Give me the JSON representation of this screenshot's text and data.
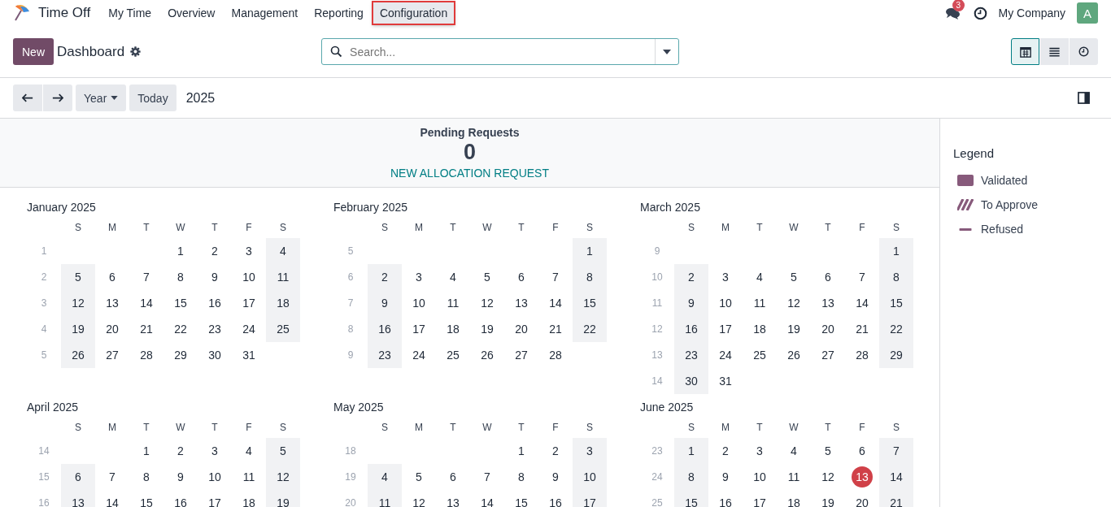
{
  "app": {
    "name": "Time Off"
  },
  "menu": [
    {
      "label": "My Time",
      "highlighted": false
    },
    {
      "label": "Overview",
      "highlighted": false
    },
    {
      "label": "Management",
      "highlighted": false
    },
    {
      "label": "Reporting",
      "highlighted": false
    },
    {
      "label": "Configuration",
      "highlighted": true
    }
  ],
  "systray": {
    "messages_badge": "3",
    "company": "My Company",
    "avatar": "A"
  },
  "control_panel": {
    "new_button": "New",
    "title": "Dashboard",
    "search": {
      "placeholder": "Search..."
    },
    "views": [
      {
        "kind": "calendar",
        "selected": true
      },
      {
        "kind": "list",
        "selected": false
      },
      {
        "kind": "activity",
        "selected": false
      }
    ]
  },
  "toolbar": {
    "scale": "Year",
    "today": "Today",
    "period": "2025"
  },
  "pending": {
    "title": "Pending Requests",
    "count": "0",
    "action": "NEW ALLOCATION REQUEST"
  },
  "months": [
    {
      "title": "January 2025",
      "weekdays": [
        "S",
        "M",
        "T",
        "W",
        "T",
        "F",
        "S"
      ],
      "weeks": [
        {
          "number": "1",
          "days": [
            "1",
            "2",
            "3",
            "4"
          ]
        },
        {
          "number": "2",
          "days": [
            "5",
            "6",
            "7",
            "8",
            "9",
            "10",
            "11"
          ]
        },
        {
          "number": "3",
          "days": [
            "12",
            "13",
            "14",
            "15",
            "16",
            "17",
            "18"
          ]
        },
        {
          "number": "4",
          "days": [
            "19",
            "20",
            "21",
            "22",
            "23",
            "24",
            "25"
          ]
        },
        {
          "number": "5",
          "days": [
            "26",
            "27",
            "28",
            "29",
            "30",
            "31"
          ]
        }
      ]
    },
    {
      "title": "February 2025",
      "weekdays": [
        "S",
        "M",
        "T",
        "W",
        "T",
        "F",
        "S"
      ],
      "weeks": [
        {
          "number": "5",
          "days": [
            "1"
          ]
        },
        {
          "number": "6",
          "days": [
            "2",
            "3",
            "4",
            "5",
            "6",
            "7",
            "8"
          ]
        },
        {
          "number": "7",
          "days": [
            "9",
            "10",
            "11",
            "12",
            "13",
            "14",
            "15"
          ]
        },
        {
          "number": "8",
          "days": [
            "16",
            "17",
            "18",
            "19",
            "20",
            "21",
            "22"
          ]
        },
        {
          "number": "9",
          "days": [
            "23",
            "24",
            "25",
            "26",
            "27",
            "28"
          ]
        }
      ]
    },
    {
      "title": "March 2025",
      "weekdays": [
        "S",
        "M",
        "T",
        "W",
        "T",
        "F",
        "S"
      ],
      "weeks": [
        {
          "number": "9",
          "days": [
            "1"
          ]
        },
        {
          "number": "10",
          "days": [
            "2",
            "3",
            "4",
            "5",
            "6",
            "7",
            "8"
          ]
        },
        {
          "number": "11",
          "days": [
            "9",
            "10",
            "11",
            "12",
            "13",
            "14",
            "15"
          ]
        },
        {
          "number": "12",
          "days": [
            "16",
            "17",
            "18",
            "19",
            "20",
            "21",
            "22"
          ]
        },
        {
          "number": "13",
          "days": [
            "23",
            "24",
            "25",
            "26",
            "27",
            "28",
            "29"
          ]
        },
        {
          "number": "14",
          "days": [
            "30",
            "31"
          ]
        }
      ]
    },
    {
      "title": "April 2025",
      "weekdays": [
        "S",
        "M",
        "T",
        "W",
        "T",
        "F",
        "S"
      ],
      "weeks": [
        {
          "number": "14",
          "days": [
            "1",
            "2",
            "3",
            "4",
            "5"
          ]
        },
        {
          "number": "15",
          "days": [
            "6",
            "7",
            "8",
            "9",
            "10",
            "11",
            "12"
          ]
        },
        {
          "number": "16",
          "days": [
            "13",
            "14",
            "15",
            "16",
            "17",
            "18",
            "19"
          ]
        }
      ]
    },
    {
      "title": "May 2025",
      "weekdays": [
        "S",
        "M",
        "T",
        "W",
        "T",
        "F",
        "S"
      ],
      "weeks": [
        {
          "number": "18",
          "days": [
            "1",
            "2",
            "3"
          ]
        },
        {
          "number": "19",
          "days": [
            "4",
            "5",
            "6",
            "7",
            "8",
            "9",
            "10"
          ]
        },
        {
          "number": "20",
          "days": [
            "11",
            "12",
            "13",
            "14",
            "15",
            "16",
            "17"
          ]
        }
      ]
    },
    {
      "title": "June 2025",
      "weekdays": [
        "S",
        "M",
        "T",
        "W",
        "T",
        "F",
        "S"
      ],
      "weeks": [
        {
          "number": "23",
          "days": [
            "1",
            "2",
            "3",
            "4",
            "5",
            "6",
            "7"
          ]
        },
        {
          "number": "24",
          "days": [
            "8",
            "9",
            "10",
            "11",
            "12",
            {
              "day": "13",
              "today": true
            },
            "14"
          ]
        },
        {
          "number": "25",
          "days": [
            "15",
            "16",
            "17",
            "18",
            "19",
            "20",
            "21"
          ]
        }
      ]
    }
  ],
  "legend": {
    "title": "Legend",
    "items": [
      {
        "label": "Validated",
        "kind": "validated"
      },
      {
        "label": "To Approve",
        "kind": "to_approve"
      },
      {
        "label": "Refused",
        "kind": "refused"
      }
    ]
  }
}
